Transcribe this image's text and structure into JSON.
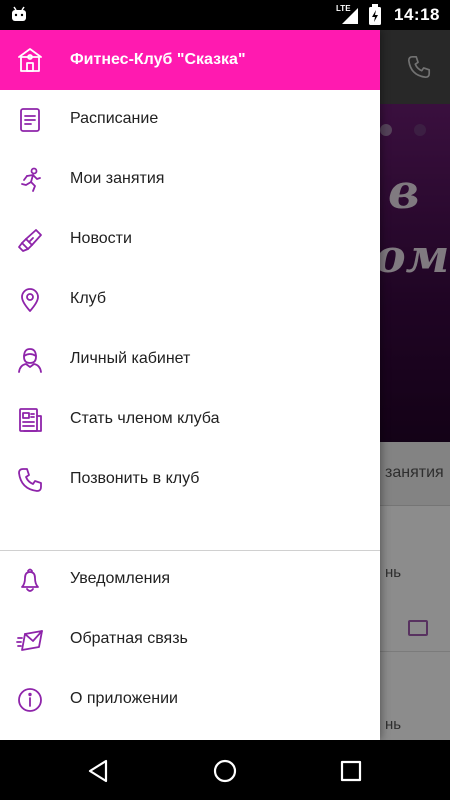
{
  "status_bar": {
    "time": "14:18",
    "network": "LTE",
    "icons": [
      "android-icon",
      "lte-signal-icon",
      "battery-charging-icon"
    ]
  },
  "background_screen": {
    "banner_text_1": "в",
    "banner_text_2": "ом",
    "tab_label": "занятия",
    "row_1_text": "нь",
    "row_2_text": "нь",
    "icons": [
      "phone-icon",
      "card-icon"
    ]
  },
  "drawer": {
    "header": {
      "title": "Фитнес-Клуб \"Сказка\"",
      "icon": "club-building-icon",
      "background_color": "#ff1ab0"
    },
    "items": [
      {
        "label": "Расписание",
        "icon": "schedule-icon"
      },
      {
        "label": "Мои занятия",
        "icon": "running-person-icon"
      },
      {
        "label": "Новости",
        "icon": "megaphone-icon"
      },
      {
        "label": "Клуб",
        "icon": "location-pin-icon"
      },
      {
        "label": "Личный кабинет",
        "icon": "person-icon"
      },
      {
        "label": "Стать членом клуба",
        "icon": "membership-form-icon"
      },
      {
        "label": "Позвонить в клуб",
        "icon": "phone-icon"
      }
    ],
    "secondary_items": [
      {
        "label": "Уведомления",
        "icon": "bell-icon"
      },
      {
        "label": "Обратная связь",
        "icon": "envelope-icon"
      },
      {
        "label": "О приложении",
        "icon": "info-icon"
      }
    ],
    "icon_color": "#8e24aa"
  },
  "nav_bar": {
    "buttons": [
      "back-icon",
      "home-icon",
      "recents-icon"
    ]
  }
}
